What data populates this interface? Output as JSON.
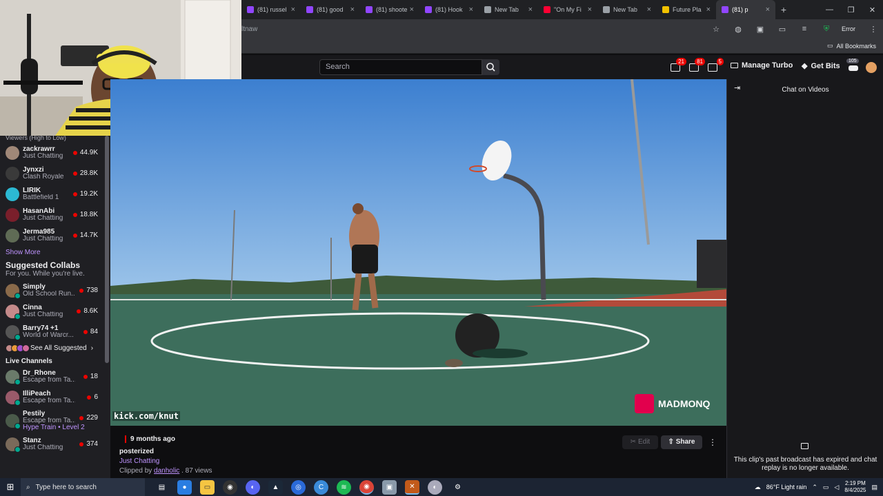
{
  "browser": {
    "tabs": [
      {
        "title": "(81) russel",
        "icon_color": "#9146ff"
      },
      {
        "title": "(81) good",
        "icon_color": "#9146ff"
      },
      {
        "title": "(81) shoote",
        "icon_color": "#9146ff"
      },
      {
        "title": "(81) Hook",
        "icon_color": "#9146ff"
      },
      {
        "title": "New Tab",
        "icon_color": "#9aa0a6"
      },
      {
        "title": "\"On My Fi",
        "icon_color": "#ff0033"
      },
      {
        "title": "New Tab",
        "icon_color": "#9aa0a6"
      },
      {
        "title": "Future Pla",
        "icon_color": "#f2c200"
      },
      {
        "title": "(81) p",
        "icon_color": "#9146ff"
      }
    ],
    "url_fragment": "ltnaw",
    "error_label": "Error",
    "bookmarks_label": "All Bookmarks"
  },
  "header": {
    "search_placeholder": "Search",
    "badges": [
      "21",
      "81",
      "5"
    ],
    "turbo_label": "Manage Turbo",
    "bits_label": "Get Bits",
    "notif_count": "105"
  },
  "sidebar": {
    "sort_label": "Viewers (High to Low)",
    "followed": [
      {
        "name": "zackrawrr",
        "game": "Just Chatting",
        "viewers": "44.9K",
        "color": "#a08878"
      },
      {
        "name": "Jynxzi",
        "game": "Clash Royale",
        "viewers": "28.8K",
        "color": "#3a3a3a"
      },
      {
        "name": "LIRIK",
        "game": "Battlefield 1",
        "viewers": "19.2K",
        "color": "#2cb9d3"
      },
      {
        "name": "HasanAbi",
        "game": "Just Chatting",
        "viewers": "18.8K",
        "color": "#7a1f2b"
      },
      {
        "name": "Jerma985",
        "game": "Just Chatting",
        "viewers": "14.7K",
        "color": "#5f6b55"
      }
    ],
    "show_more": "Show More",
    "collabs_title": "Suggested Collabs",
    "collabs_sub": "For you. While you're live.",
    "collabs": [
      {
        "name": "Simply",
        "game": "Old School Run...",
        "viewers": "738",
        "color": "#8a6a4a"
      },
      {
        "name": "Cinna",
        "game": "Just Chatting",
        "viewers": "8.6K",
        "color": "#c48a8a"
      },
      {
        "name": "Barry74 +1",
        "game": "World of Warcr...",
        "viewers": "84",
        "color": "#555555"
      }
    ],
    "see_all": "See All Suggested",
    "live_title": "Live Channels",
    "live": [
      {
        "name": "Dr_Rhone",
        "game": "Escape from Ta...",
        "viewers": "18",
        "color": "#6a7a6a"
      },
      {
        "name": "IlliPeach",
        "game": "Escape from Ta...",
        "viewers": "6",
        "color": "#9a5a6a"
      },
      {
        "name": "Pestily",
        "game": "Escape from Ta...",
        "viewers": "229",
        "color": "#4a5a4a"
      },
      {
        "name": "Stanz",
        "game": "Just Chatting",
        "viewers": "374",
        "color": "#7a6a5a"
      }
    ],
    "hype_train": "Hype Train • Level 2"
  },
  "video": {
    "watermark_left": "kick.com/knut",
    "watermark_right": "MADMONQ",
    "time_ago": "9 months ago",
    "title": "posterized",
    "category": "Just Chatting",
    "clipped_prefix": "Clipped by",
    "clipper": "danholic",
    "views": " . 87 views",
    "edit_label": "Edit",
    "share_label": "Share"
  },
  "chat": {
    "title": "Chat on Videos",
    "message": "This clip's past broadcast has expired and chat replay is no longer available."
  },
  "taskbar": {
    "search_placeholder": "Type here to search",
    "weather": "86°F  Light rain",
    "time": "2:19 PM",
    "date": "8/4/2025"
  }
}
